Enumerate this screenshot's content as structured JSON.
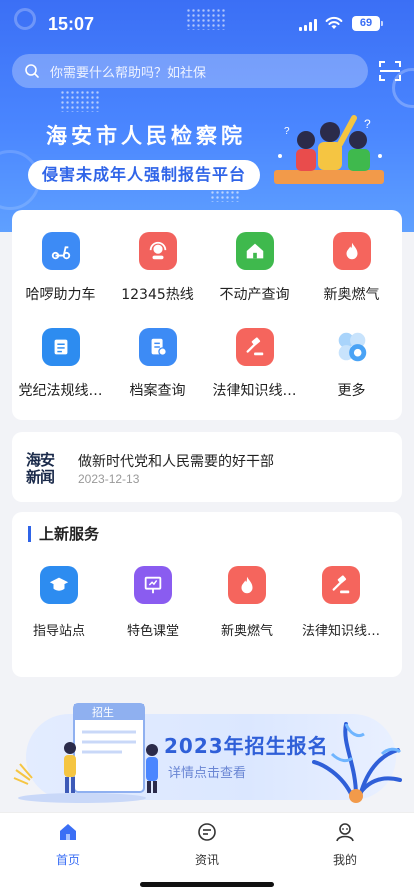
{
  "status_bar": {
    "time": "15:07",
    "battery": "69"
  },
  "search": {
    "placeholder": "你需要什么帮助吗？如社保"
  },
  "hero": {
    "title": "海安市人民检察院",
    "subtitle": "侵害未成年人强制报告平台"
  },
  "quick_services": [
    {
      "label": "哈啰助力车",
      "icon": "scooter-icon",
      "color": "#3d8bf5"
    },
    {
      "label": "12345热线",
      "icon": "hotline-icon",
      "color": "#f2625d"
    },
    {
      "label": "不动产查询",
      "icon": "house-icon",
      "color": "#3fb94d"
    },
    {
      "label": "新奥燃气",
      "icon": "flame-icon",
      "color": "#f5655d"
    },
    {
      "label": "党纪法规线…",
      "icon": "regulation-icon",
      "color": "#2d8cf0"
    },
    {
      "label": "档案查询",
      "icon": "archive-icon",
      "color": "#3d8bf5"
    },
    {
      "label": "法律知识线…",
      "icon": "gavel-icon",
      "color": "#f5655d"
    },
    {
      "label": "更多",
      "icon": "more-icon",
      "color": "#4aa3f5"
    }
  ],
  "news": {
    "logo_line1": "海安",
    "logo_line2": "新闻",
    "title": "做新时代党和人民需要的好干部",
    "date": "2023-12-13"
  },
  "new_services": {
    "title": "上新服务",
    "items": [
      {
        "label": "指导站点",
        "icon": "graduation-cap-icon",
        "color": "#2d8cf0"
      },
      {
        "label": "特色课堂",
        "icon": "classroom-icon",
        "color": "#8a5cf0"
      },
      {
        "label": "新奥燃气",
        "icon": "flame-icon",
        "color": "#f5655d"
      },
      {
        "label": "法律知识线…",
        "icon": "gavel-icon",
        "color": "#f5655d"
      }
    ]
  },
  "banner": {
    "tag": "招生",
    "title": "2023年招生报名",
    "subtitle": "详情点击查看"
  },
  "tabbar": {
    "items": [
      {
        "label": "首页",
        "icon": "home-icon",
        "active": true
      },
      {
        "label": "资讯",
        "icon": "chat-icon",
        "active": false
      },
      {
        "label": "我的",
        "icon": "profile-icon",
        "active": false
      }
    ]
  },
  "colors": {
    "accent": "#3b6ff5",
    "hero_bg": "#4a86ff"
  }
}
